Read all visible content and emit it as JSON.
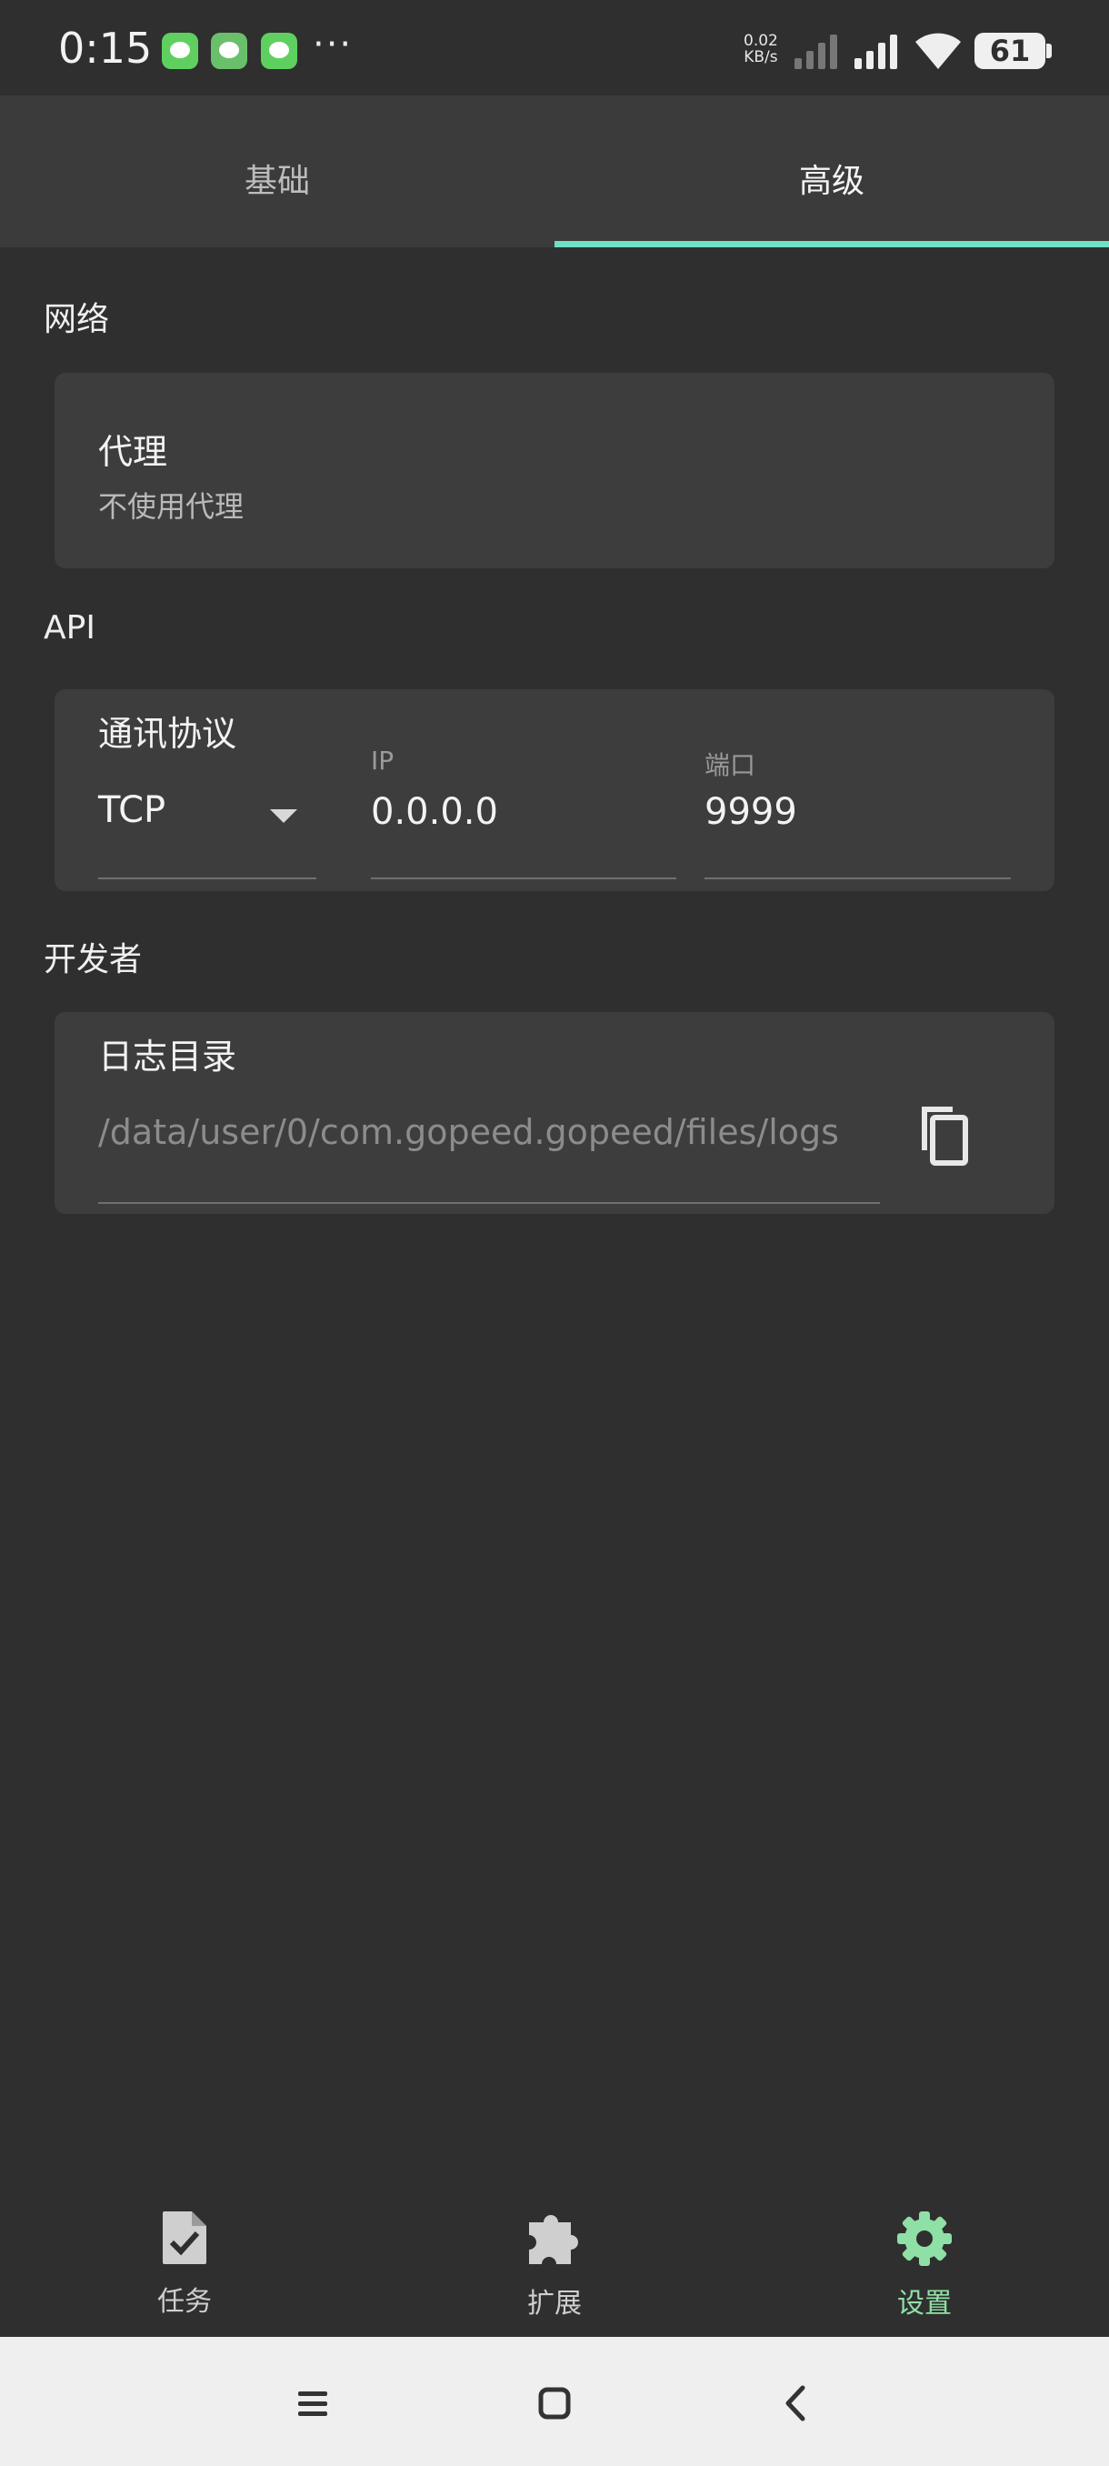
{
  "status_bar": {
    "time": "0:15",
    "net_speed_value": "0.02",
    "net_speed_unit": "KB/s",
    "battery_level": "61",
    "more_notifications": "···"
  },
  "tabs": [
    {
      "label": "基础",
      "active": false
    },
    {
      "label": "高级",
      "active": true
    }
  ],
  "colors": {
    "accent": "#6ee0c3",
    "active_nav": "#8fe0a6",
    "background": "#2f2f2f",
    "card": "#3d3d3d"
  },
  "network": {
    "section_title": "网络",
    "proxy_title": "代理",
    "proxy_value": "不使用代理"
  },
  "api": {
    "section_title": "API",
    "protocol_label": "通讯协议",
    "protocol_value": "TCP",
    "ip_label": "IP",
    "ip_value": "0.0.0.0",
    "port_label": "端口",
    "port_value": "9999"
  },
  "developer": {
    "section_title": "开发者",
    "log_dir_label": "日志目录",
    "log_dir_value": "/data/user/0/com.gopeed.gopeed/files/logs",
    "copy_icon": "copy-icon"
  },
  "bottom_nav": [
    {
      "label": "任务",
      "icon": "task-icon",
      "active": false
    },
    {
      "label": "扩展",
      "icon": "extension-icon",
      "active": false
    },
    {
      "label": "设置",
      "icon": "settings-icon",
      "active": true
    }
  ],
  "system_nav": {
    "menu_icon": "menu-icon",
    "home_icon": "home-icon",
    "back_icon": "back-icon"
  }
}
